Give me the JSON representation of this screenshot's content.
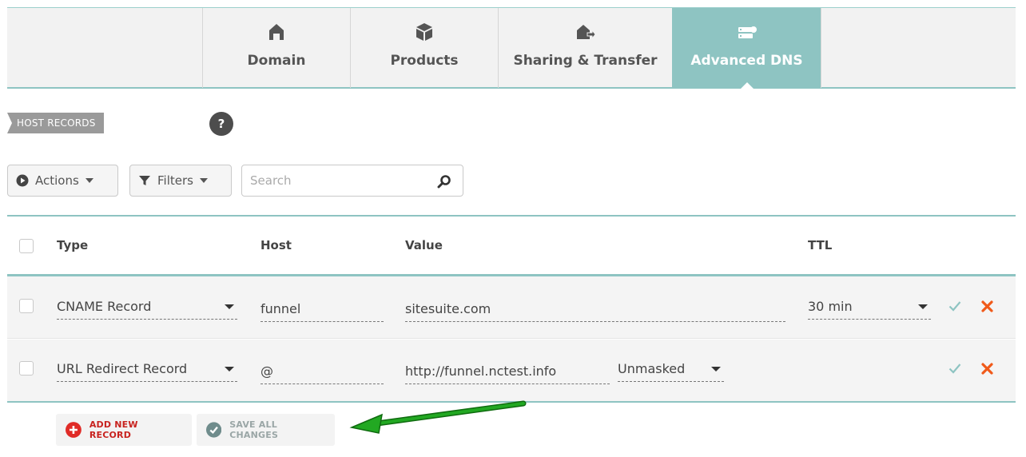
{
  "tabs": [
    {
      "label": "Domain",
      "icon": "home-icon",
      "active": false
    },
    {
      "label": "Products",
      "icon": "box-icon",
      "active": false
    },
    {
      "label": "Sharing & Transfer",
      "icon": "house-transfer-icon",
      "active": false
    },
    {
      "label": "Advanced DNS",
      "icon": "server-icon",
      "active": true
    }
  ],
  "section": {
    "label": "HOST RECORDS",
    "help": "?"
  },
  "toolbar": {
    "actions_label": "Actions",
    "filters_label": "Filters",
    "search_placeholder": "Search"
  },
  "table": {
    "headers": {
      "type": "Type",
      "host": "Host",
      "value": "Value",
      "ttl": "TTL"
    },
    "rows": [
      {
        "type": "CNAME Record",
        "host": "funnel",
        "value": "sitesuite.com",
        "ttl": "30 min"
      },
      {
        "type": "URL Redirect Record",
        "host": "@",
        "value": "http://funnel.nctest.info",
        "redirect_mode": "Unmasked"
      }
    ]
  },
  "footer": {
    "add_label": "ADD NEW RECORD",
    "save_label": "SAVE ALL CHANGES"
  },
  "colors": {
    "accent_teal": "#8ec4c2",
    "delete_orange": "#f05a1a",
    "confirm_teal": "#8ec4c2",
    "add_red": "#e02b27",
    "annotation_arrow": "#1f9d1f"
  }
}
